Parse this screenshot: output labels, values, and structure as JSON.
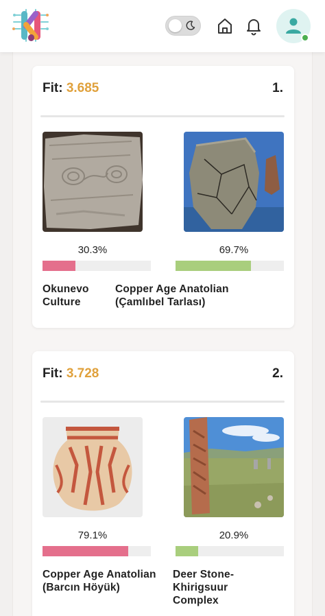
{
  "header": {
    "logo_icon": "logo-icon",
    "theme_toggle_icon": "moon-icon",
    "home_icon": "home-icon",
    "notification_icon": "bell-icon",
    "avatar_icon": "user-icon"
  },
  "results": [
    {
      "fit_label": "Fit:",
      "fit_value": "3.685",
      "rank": "1.",
      "left": {
        "percent": "30.3%",
        "fraction": 0.303,
        "name": "Okunevo\nCulture",
        "bar_color": "#e46f8c",
        "image": "carved-stone-slab-image"
      },
      "right": {
        "percent": "69.7%",
        "fraction": 0.697,
        "name": "Copper Age Anatolian\n(Çamlıbel Tarlası)",
        "bar_color": "#a9ce7d",
        "image": "cracked-ceramic-pot-image"
      }
    },
    {
      "fit_label": "Fit:",
      "fit_value": "3.728",
      "rank": "2.",
      "left": {
        "percent": "79.1%",
        "fraction": 0.791,
        "name": "Copper Age Anatolian\n(Barcın Höyük)",
        "bar_color": "#e46f8c",
        "image": "painted-clay-jar-image"
      },
      "right": {
        "percent": "20.9%",
        "fraction": 0.209,
        "name": "Deer Stone-\nKhirigsuur\nComplex",
        "bar_color": "#a9ce7d",
        "image": "standing-deer-stone-image"
      }
    }
  ],
  "colors": {
    "accent": "#e0a13c",
    "online": "#4caf50"
  }
}
